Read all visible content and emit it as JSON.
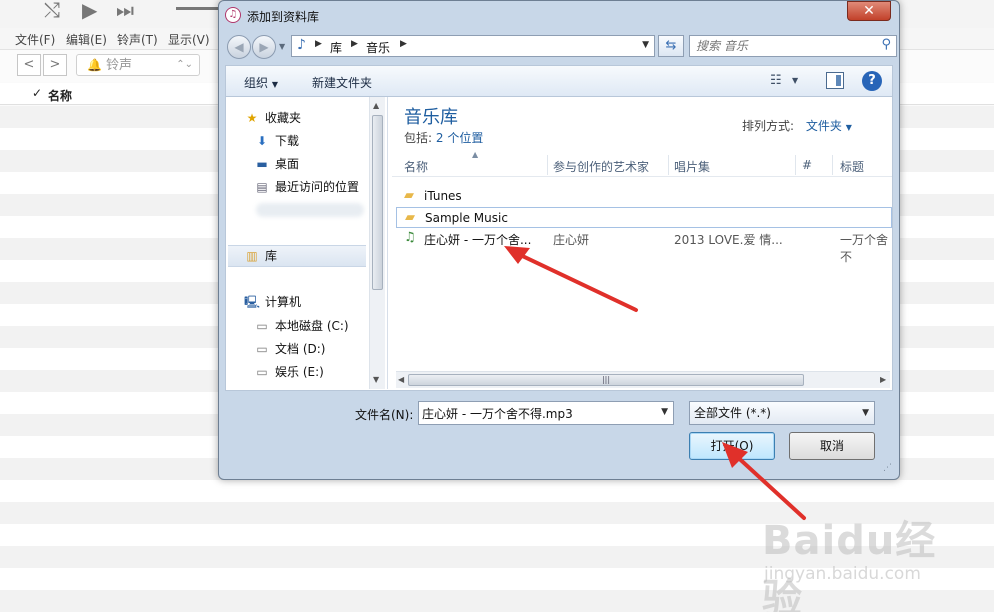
{
  "itunes": {
    "menu": [
      "文件(F)",
      "编辑(E)",
      "铃声(T)",
      "显示(V)"
    ],
    "nav_back": "<",
    "nav_forward": ">",
    "ringtone_label": "铃声",
    "column_check": "✓",
    "column_name": "名称"
  },
  "dialog": {
    "title": "添加到资料库",
    "close": "✕",
    "address": {
      "crumbs": [
        "库",
        "音乐"
      ],
      "search_placeholder": "搜索 音乐"
    },
    "toolbar": {
      "organize": "组织",
      "new_folder": "新建文件夹"
    },
    "nav": {
      "favorites": "收藏夹",
      "downloads": "下载",
      "desktop": "桌面",
      "recent": "最近访问的位置",
      "library": "库",
      "computer": "计算机",
      "drive_c": "本地磁盘 (C:)",
      "drive_d": "文档 (D:)",
      "drive_e": "娱乐 (E:)"
    },
    "content": {
      "library_title": "音乐库",
      "includes_label": "包括:",
      "includes_link": "2 个位置",
      "arrange_label": "排列方式:",
      "arrange_value": "文件夹",
      "columns": [
        "名称",
        "参与创作的艺术家",
        "唱片集",
        "#",
        "标题"
      ],
      "files": [
        {
          "name": "iTunes",
          "type": "folder"
        },
        {
          "name": "Sample Music",
          "type": "folder"
        },
        {
          "name": "庄心妍 - 一万个舍...",
          "type": "music",
          "artist": "庄心妍",
          "album": "2013 LOVE.爱 情...",
          "title": "一万个舍不"
        }
      ]
    },
    "filename_label": "文件名(N):",
    "filename_value": "庄心妍 - 一万个舍不得.mp3",
    "filetype_value": "全部文件 (*.*)",
    "open_button": "打开(O)",
    "cancel_button": "取消"
  },
  "watermark": {
    "logo_text": "Baidu经验",
    "url": "jingyan.baidu.com"
  },
  "colors": {
    "accent_blue": "#1f5ea0",
    "arrow_red": "#e0302a",
    "close_red": "#c2412a"
  }
}
